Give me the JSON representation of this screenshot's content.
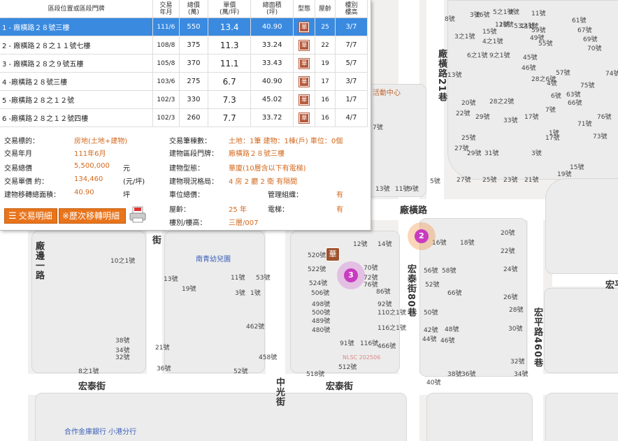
{
  "table": {
    "headers": {
      "addr": "區段位置或區段門牌",
      "ym": "交易\n年月",
      "total": "總價\n(萬)",
      "unit": "單價\n(萬/坪)",
      "area": "總面積\n(坪)",
      "type": "型態",
      "age": "屋齡",
      "floor": "樓別\n樓高"
    },
    "rows": [
      {
        "addr": "1 - 廠橫路２８號三樓",
        "ym": "111/6",
        "total": "550",
        "unit": "13.4",
        "area": "40.90",
        "type": "華",
        "age": "25",
        "floor": "3/7",
        "selected": true
      },
      {
        "addr": "2 - 廠橫路２８之１１號七樓",
        "ym": "108/8",
        "total": "375",
        "unit": "11.3",
        "area": "33.24",
        "type": "華",
        "age": "22",
        "floor": "7/7"
      },
      {
        "addr": "3 - 廠橫路２８之９號五樓",
        "ym": "105/8",
        "total": "370",
        "unit": "11.1",
        "area": "33.43",
        "type": "華",
        "age": "19",
        "floor": "5/7"
      },
      {
        "addr": "4 -廠橫路２８號三樓",
        "ym": "103/6",
        "total": "275",
        "unit": "6.7",
        "area": "40.90",
        "type": "華",
        "age": "17",
        "floor": "3/7"
      },
      {
        "addr": "5 -廠橫路２８之１２號",
        "ym": "102/3",
        "total": "330",
        "unit": "7.3",
        "area": "45.02",
        "type": "華",
        "age": "16",
        "floor": "1/7"
      },
      {
        "addr": "6 -廠橫路２８之１２號四樓",
        "ym": "102/3",
        "total": "260",
        "unit": "7.7",
        "area": "33.72",
        "type": "華",
        "age": "16",
        "floor": "4/7"
      }
    ]
  },
  "detail": {
    "target_label": "交易標的：",
    "target": "房地(土地+建物)",
    "ym_label": "交易年月",
    "ym": "111年6月",
    "total_label": "交易總價",
    "total": "5,500,000",
    "total_unit": "元",
    "unit_label": "交易單價 約：",
    "unit": "134,460",
    "unit_unit": "(元/坪)",
    "area_label": "建物移轉總面積：",
    "area": "40.90",
    "area_unit": "坪",
    "count_label": "交易筆棟數：",
    "count": "土地：1筆 建物：1棟(戶) 車位：0個",
    "addr_label": "建物區段門牌：",
    "addr": "廠橫路２８號三樓",
    "btype_label": "建物型態：",
    "btype": "華廈(10層含以下有電梯)",
    "layout_label": "建物現況格局：",
    "layout": "4 房 2 廳 2 衛 有隔間",
    "parking_label": "車位總價：",
    "parking": "",
    "mgmt_label": "管理組織：",
    "mgmt": "有",
    "age_label": "屋齡：",
    "age": "25 年",
    "elev_label": "電梯：",
    "elev": "有",
    "floor_label": "樓別/樓高：",
    "floor": "三層/007",
    "btn_detail": "交易明細",
    "btn_history": "※歷次移轉明細"
  },
  "map": {
    "roads": {
      "changheng": "廠橫路",
      "changheng21": "廠橫路21巷",
      "hongtai": "宏泰街",
      "hongtai80": "宏泰街80巷",
      "hongping460": "宏平路460巷",
      "zhongguang": "中光街",
      "changbian1": "廠邊一路",
      "hongping_top": "宏平",
      "jie": "街"
    },
    "pois": {
      "kindergarten": "南青幼兒園",
      "activity": "活動中心",
      "coop": "合作金庫銀行 小港分行"
    },
    "markers": [
      {
        "num": "2"
      },
      {
        "num": "3"
      }
    ],
    "watermark": "NLSC 202506",
    "numbers": [
      "5之1號",
      "3號",
      "9號",
      "11號",
      "8號",
      "16號",
      "12號",
      "53之1號",
      "18號",
      "14號",
      "15號",
      "59號",
      "61號",
      "67號",
      "69號",
      "70號",
      "74號",
      "76號",
      "73號",
      "71號",
      "75號",
      "66號",
      "63號",
      "57號",
      "55號",
      "49號",
      "45號",
      "46號",
      "4號",
      "6號",
      "7號",
      "3之1號",
      "4之1號",
      "6之1號",
      "9之1號",
      "13號",
      "20號",
      "22號",
      "25號",
      "27號",
      "29號",
      "31號",
      "33號",
      "17號",
      "28之6號",
      "28之2號",
      "29號",
      "27號",
      "25號",
      "23號",
      "21號",
      "19號",
      "17號",
      "15號",
      "13號",
      "11號",
      "9號",
      "7號",
      "5號",
      "3號",
      "1號",
      "12號",
      "14號",
      "16號",
      "18號",
      "20號",
      "22號",
      "24號",
      "26號",
      "28號",
      "30號",
      "32號",
      "34號",
      "36號",
      "38號",
      "40號",
      "42號",
      "44號",
      "46號",
      "48號",
      "50號",
      "52號",
      "56號",
      "58號",
      "66號",
      "70號",
      "72號",
      "76號",
      "86號",
      "92號",
      "110之1號",
      "116之1號",
      "116號",
      "512號",
      "518號",
      "520號",
      "522號",
      "524號",
      "506號",
      "498號",
      "500號",
      "489號",
      "480號",
      "91號",
      "466號",
      "462號",
      "458號",
      "52號",
      "53號",
      "3號",
      "1號",
      "11號",
      "13號",
      "19號",
      "21號",
      "36號",
      "38號",
      "34號",
      "32號",
      "8之1號",
      "10之1號"
    ]
  }
}
